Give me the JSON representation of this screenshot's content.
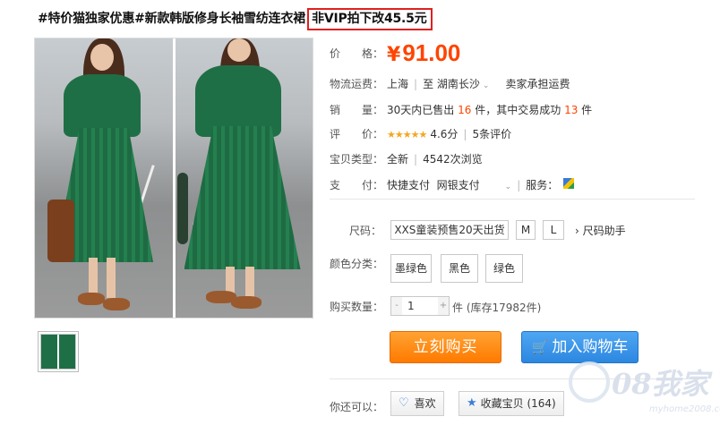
{
  "product": {
    "title": "#特价猫独家优惠#新款韩版修身长袖雪纺连衣裙",
    "title_highlight": "非VIP拍下改45.5元"
  },
  "price": {
    "label": "价　　格：",
    "currency": "¥",
    "value": "91.00"
  },
  "shipping": {
    "label": "物流运费：",
    "from": "上海",
    "to_word": "至",
    "to": "湖南长沙",
    "note": "卖家承担运费"
  },
  "sales": {
    "label": "销　　量：",
    "text1": "30天内已售出",
    "sold": "16",
    "text2": "件，其中交易成功",
    "success": "13",
    "text3": "件"
  },
  "rating": {
    "label": "评　　价：",
    "stars": "★★★★★",
    "score": "4.6分",
    "reviews": "5条评价"
  },
  "item_type": {
    "label": "宝贝类型：",
    "condition": "全新",
    "views": "4542次浏览"
  },
  "payment": {
    "label": "支　　付：",
    "methods": "快捷支付",
    "bank": "网银支付",
    "service_label": "服务："
  },
  "sizes": {
    "label": "尺码：",
    "options": [
      "XXS童装预售20天出货",
      "M",
      "L"
    ],
    "help": "尺码助手"
  },
  "colors": {
    "label": "颜色分类：",
    "options": [
      "墨绿色",
      "黑色",
      "绿色"
    ]
  },
  "quantity": {
    "label": "购买数量：",
    "value": "1",
    "minus": "-",
    "plus": "+",
    "stock": "件 (库存17982件)"
  },
  "actions": {
    "buy_now": "立刻购买",
    "add_cart": "加入购物车"
  },
  "share": {
    "label": "你还可以：",
    "like": "喜欢",
    "favorite": "收藏宝贝 (164)"
  },
  "watermark": {
    "text": "08我家",
    "url": "myhome2008.com"
  },
  "colors_theme": {
    "price": "#ff4400",
    "buy": "#ff8a00",
    "cart": "#3a96ea",
    "highlight_border": "#e02020"
  },
  "icons": {
    "rating": "star-icon",
    "like": "heart-icon",
    "favorite": "star-icon",
    "cart": "cart-icon",
    "service": "shield-icon"
  }
}
